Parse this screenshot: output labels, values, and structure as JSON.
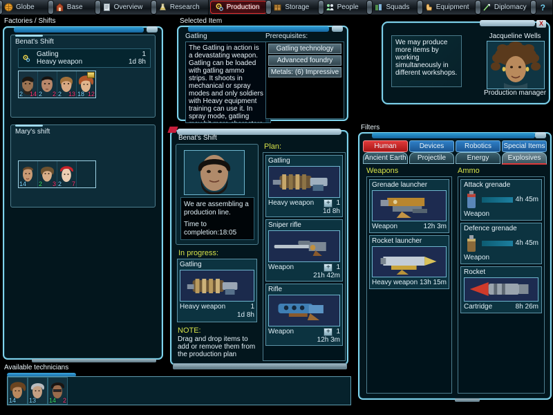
{
  "nav": {
    "tabs": [
      {
        "label": "Globe",
        "icon": "globe-icon",
        "active": false
      },
      {
        "label": "Base",
        "icon": "base-icon",
        "active": false
      },
      {
        "label": "Overview",
        "icon": "document-icon",
        "active": false
      },
      {
        "label": "Research",
        "icon": "flask-icon",
        "active": false
      },
      {
        "label": "Production",
        "icon": "gear-icon",
        "active": true
      },
      {
        "label": "Storage",
        "icon": "crate-icon",
        "active": false
      },
      {
        "label": "People",
        "icon": "people-icon",
        "active": false
      },
      {
        "label": "Squads",
        "icon": "squad-icon",
        "active": false
      },
      {
        "label": "Equipment",
        "icon": "glove-icon",
        "active": false
      },
      {
        "label": "Diplomacy",
        "icon": "diplomacy-icon",
        "active": false
      }
    ],
    "help_label": "?"
  },
  "factories": {
    "title": "Factories / Shifts",
    "shifts": [
      {
        "name": "Benat's Shift",
        "job": {
          "item": "Gatling",
          "category": "Heavy weapon",
          "qty": "1",
          "time": "1d 8h",
          "icon": "gear-icon"
        },
        "workers": [
          {
            "left": "2",
            "right": "14",
            "right_color": "pink",
            "badge": false
          },
          {
            "left": "2",
            "right": "2",
            "right_color": "pink",
            "badge": false
          },
          {
            "left": "2",
            "right": "13",
            "right_color": "pink",
            "badge": false
          },
          {
            "left": "18",
            "right": "12",
            "right_color": "pink",
            "badge": true
          }
        ]
      },
      {
        "name": "Mary's shift",
        "workers": [
          {
            "left": "14",
            "right": "",
            "right_color": "pink",
            "badge": false
          },
          {
            "left": "2",
            "right": "3",
            "right_color": "pink",
            "badge": false
          },
          {
            "left": "2",
            "right": "7",
            "right_color": "pink",
            "badge": false
          },
          {
            "left": "",
            "right": "",
            "right_color": "pink",
            "badge": false,
            "empty": true
          }
        ]
      }
    ]
  },
  "selected_item": {
    "title": "Selected Item",
    "name": "Gatling",
    "description": "The Gatling in action is a devastating weapon. Gatling can be loaded with gatling ammo strips. It shoots in mechanical or spray modes and only soldiers with Heavy equipment training can use it. In spray mode, gatling may hit more characters in the shooting space",
    "prerequisites_label": "Prerequisites:",
    "prerequisites": [
      "Gatling technology",
      "Advanced foundry",
      "Metals: (6) Impressive"
    ]
  },
  "advisor": {
    "message": "We may produce more items by working simultaneously in different workshops.",
    "name": "Jacqueline Wells",
    "role": "Production manager",
    "close_label": "X"
  },
  "shift_detail": {
    "title": "Benat's Shift",
    "status_line1": "We are assembling a production line.",
    "status_line2": "Time to completion:18:05",
    "in_progress_label": "In progress:",
    "in_progress": {
      "name": "Gatling",
      "category": "Heavy weapon",
      "qty": "1",
      "time": "1d 8h"
    },
    "note_label": "NOTE:",
    "note_text": "Drag and drop items to add or remove them from the production plan",
    "plan_label": "Plan:",
    "plan": [
      {
        "name": "Gatling",
        "category": "Heavy weapon",
        "qty": "1",
        "time": "1d 8h",
        "plus": "+"
      },
      {
        "name": "Sniper rifle",
        "category": "Weapon",
        "qty": "1",
        "time": "21h 42m",
        "plus": "+"
      },
      {
        "name": "Rifle",
        "category": "Weapon",
        "qty": "1",
        "time": "12h 3m",
        "plus": "+"
      }
    ]
  },
  "filters": {
    "title": "Filters",
    "tabs_row1": [
      {
        "label": "Human Weapons",
        "selected": true
      },
      {
        "label": "Devices",
        "selected": false
      },
      {
        "label": "Robotics",
        "selected": false
      },
      {
        "label": "Special Items",
        "selected": false
      }
    ],
    "tabs_row2": [
      {
        "label": "Ancient Earth",
        "selected": false
      },
      {
        "label": "Projectile",
        "selected": false
      },
      {
        "label": "Energy",
        "selected": false
      },
      {
        "label": "Explosives",
        "selected": true
      }
    ],
    "columns": [
      {
        "header": "Weapons",
        "items": [
          {
            "name": "Grenade launcher",
            "category": "Weapon",
            "time": "12h 3m"
          },
          {
            "name": "Rocket launcher",
            "category": "Heavy weapon",
            "time": "13h 15m"
          }
        ]
      },
      {
        "header": "Ammo",
        "items": [
          {
            "name": "Attack grenade",
            "category": "Weapon",
            "time": "4h 45m",
            "compact": true
          },
          {
            "name": "Defence grenade",
            "category": "Weapon",
            "time": "4h 45m",
            "compact": true
          },
          {
            "name": "Rocket",
            "category": "Cartridge",
            "time": "8h 26m",
            "compact": false
          }
        ]
      }
    ]
  },
  "technicians": {
    "title": "Available technicians",
    "people": [
      {
        "left": "14",
        "right": "",
        "right_color": "pink"
      },
      {
        "left": "13",
        "right": "",
        "right_color": "pink"
      },
      {
        "left": "14",
        "right": "2",
        "right_color": "pink"
      }
    ]
  },
  "colors": {
    "accent_cyan": "#7fd3ec",
    "accent_yellow": "#d7e24a",
    "accent_red": "#e03a3a",
    "panel_bg": "#03161d",
    "blue_tab": "#2f7fc6"
  }
}
